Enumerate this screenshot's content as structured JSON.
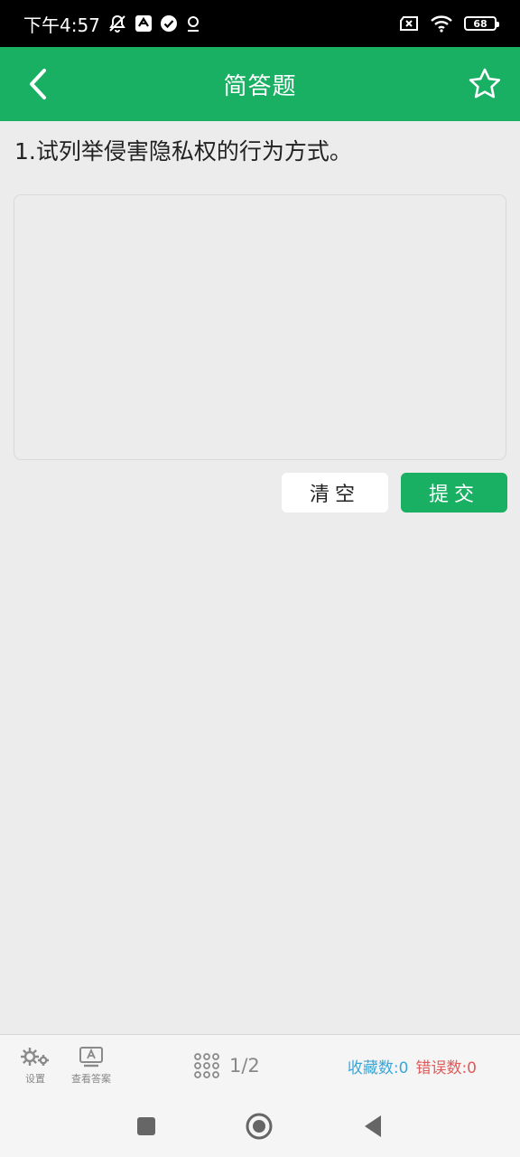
{
  "status_bar": {
    "time": "下午4:57",
    "battery": "68",
    "icons": [
      "mute-notification-icon",
      "sync-icon",
      "check-circle-icon",
      "location-icon",
      "no-sim-icon",
      "wifi-icon",
      "battery-icon"
    ]
  },
  "header": {
    "title": "简答题",
    "back_icon": "chevron-left-icon",
    "favorite_icon": "star-outline-icon"
  },
  "question": {
    "text": "1.试列举侵害隐私权的行为方式。"
  },
  "answer": {
    "value": "",
    "placeholder": ""
  },
  "buttons": {
    "clear": "清空",
    "submit": "提交"
  },
  "toolbar": {
    "settings_label": "设置",
    "view_answer_label": "查看答案",
    "progress": "1/2",
    "favorites": "收藏数:0",
    "errors": "错误数:0"
  },
  "colors": {
    "brand": "#1ab064",
    "favorites": "#3aa7d6",
    "errors": "#e05a5a"
  }
}
